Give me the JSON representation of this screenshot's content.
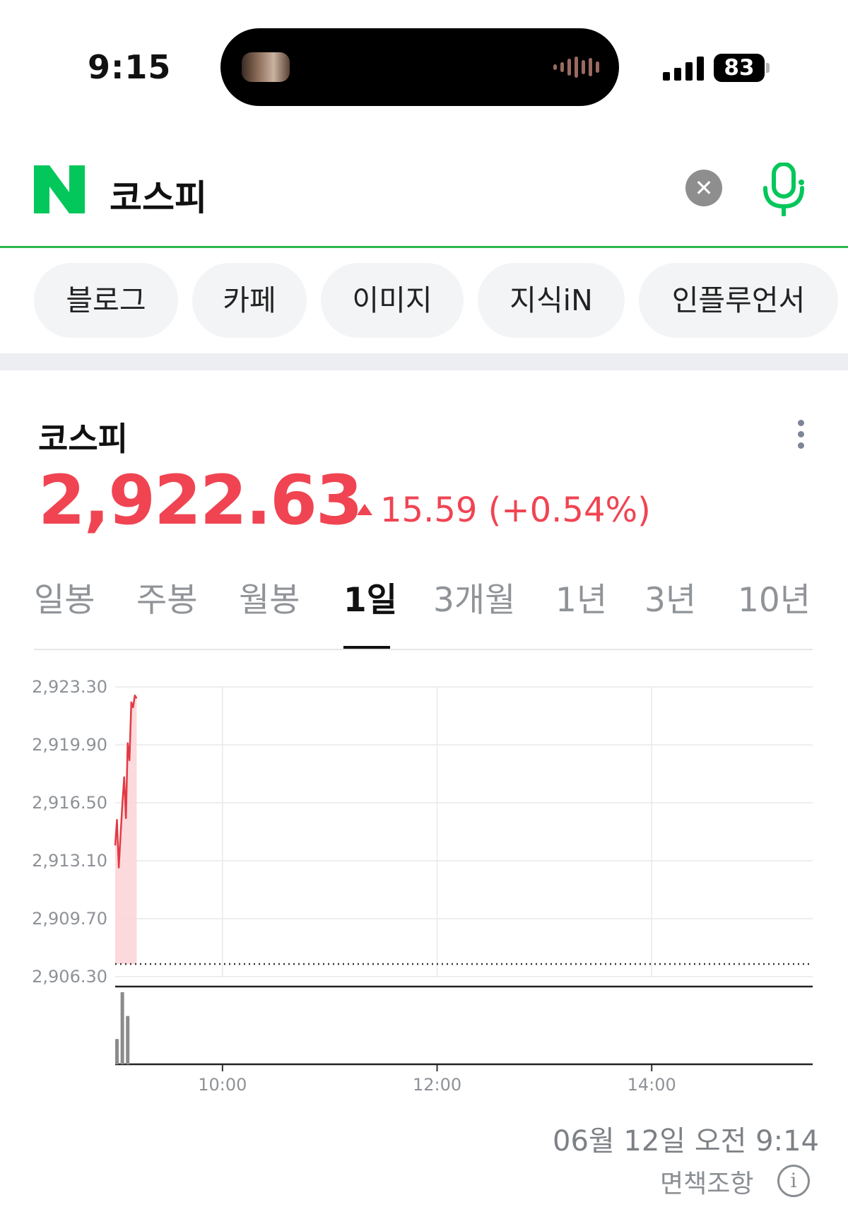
{
  "status_bar": {
    "time": "9:15",
    "battery": "83"
  },
  "search": {
    "query": "코스피",
    "clear_icon": "close-icon",
    "voice_icon": "microphone-icon"
  },
  "chips": [
    "블로그",
    "카페",
    "이미지",
    "지식iN",
    "인플루언서"
  ],
  "stock": {
    "name": "코스피",
    "price": "2,922.63",
    "change": "15.59 (+0.54%)",
    "direction": "up",
    "color_up": "#f04452"
  },
  "tabs": [
    "일봉",
    "주봉",
    "월봉",
    "1일",
    "3개월",
    "1년",
    "3년",
    "10년"
  ],
  "active_tab": "1일",
  "chart_data": {
    "type": "line",
    "y_ticks": [
      "2,923.30",
      "2,919.90",
      "2,916.50",
      "2,913.10",
      "2,909.70",
      "2,906.30"
    ],
    "x_ticks": [
      "10:00",
      "12:00",
      "14:00"
    ],
    "ylim": [
      2906.3,
      2923.3
    ],
    "x_range": [
      "09:00",
      "15:30"
    ],
    "baseline": 2907.04,
    "series": [
      {
        "values": [
          {
            "t": "09:00",
            "v": 2914.0
          },
          {
            "t": "09:01",
            "v": 2915.5
          },
          {
            "t": "09:02",
            "v": 2912.7
          },
          {
            "t": "09:03",
            "v": 2914.6
          },
          {
            "t": "09:04",
            "v": 2916.4
          },
          {
            "t": "09:05",
            "v": 2918.0
          },
          {
            "t": "09:06",
            "v": 2915.6
          },
          {
            "t": "09:07",
            "v": 2920.0
          },
          {
            "t": "09:08",
            "v": 2919.0
          },
          {
            "t": "09:09",
            "v": 2922.4
          },
          {
            "t": "09:10",
            "v": 2922.1
          },
          {
            "t": "09:11",
            "v": 2922.8
          },
          {
            "t": "09:12",
            "v": 2922.63
          }
        ]
      }
    ],
    "volume": [
      {
        "t": "09:01",
        "v": 0.35
      },
      {
        "t": "09:04",
        "v": 1.0
      },
      {
        "t": "09:07",
        "v": 0.67
      }
    ],
    "line_color": "#e23a44",
    "fill_color": "#fbd5d8",
    "grid": true
  },
  "footer": {
    "timestamp": "06월 12일 오전 9:14",
    "disclaimer": "면책조항"
  }
}
